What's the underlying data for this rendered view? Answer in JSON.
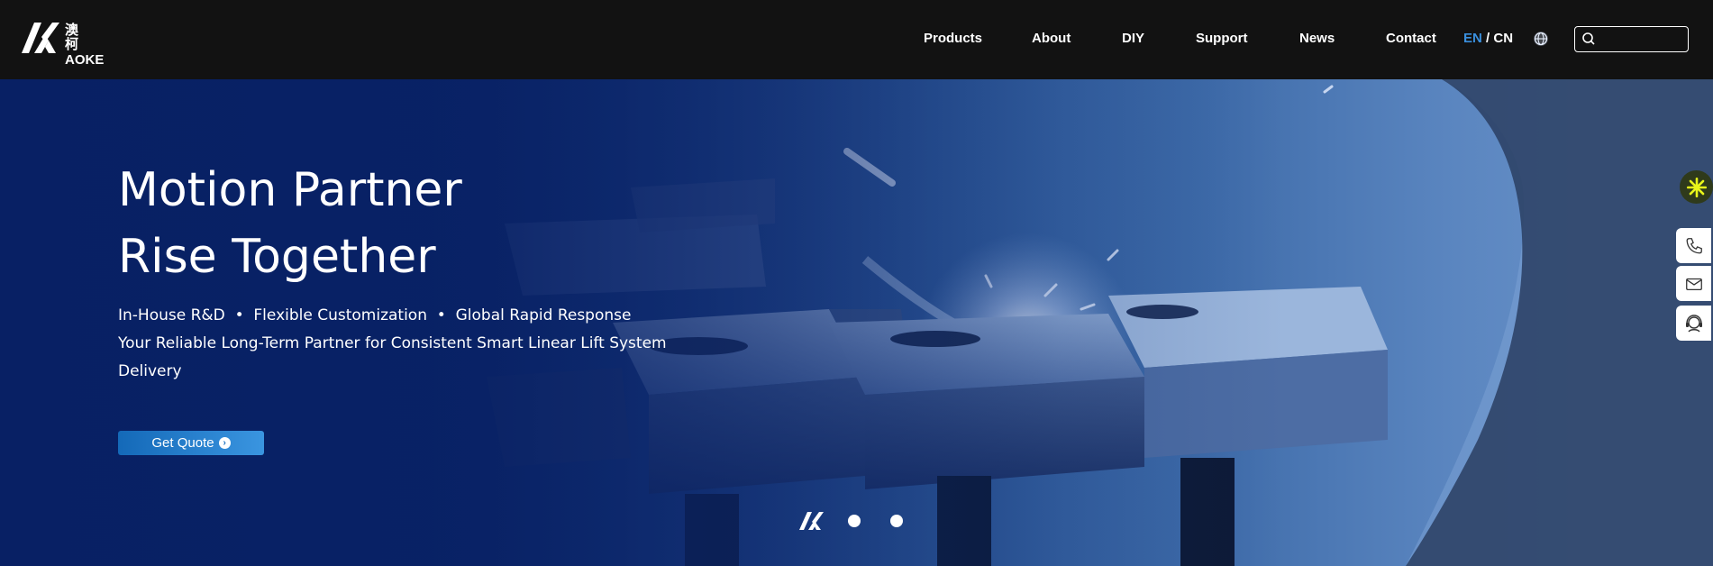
{
  "header": {
    "logo": {
      "cn": "澳 柯",
      "en": "AOKE"
    },
    "nav": [
      {
        "label": "Products"
      },
      {
        "label": "About"
      },
      {
        "label": "DIY"
      },
      {
        "label": "Support"
      },
      {
        "label": "News"
      },
      {
        "label": "Contact"
      }
    ],
    "lang": {
      "en": "EN",
      "separator": " / ",
      "cn": "CN"
    },
    "search": {
      "placeholder": "",
      "icon": "search-icon"
    },
    "globe_icon": "globe-icon"
  },
  "hero": {
    "headline_line1": "Motion Partner",
    "headline_line2": "Rise Together",
    "tagline": "In-House R&D  •  Flexible Customization  •  Global Rapid Response",
    "description": "Your Reliable Long-Term Partner for Consistent Smart Linear Lift System Delivery",
    "cta_label": "Get Quote",
    "slides": 3,
    "active_slide": 1
  },
  "side_tools": [
    "phone-icon",
    "email-icon",
    "support-agent-icon"
  ],
  "colors": {
    "header_bg": "#121212",
    "accent": "#3a8fdd",
    "hero_blue": "#0b2a6b",
    "button": "#1a78c8"
  }
}
